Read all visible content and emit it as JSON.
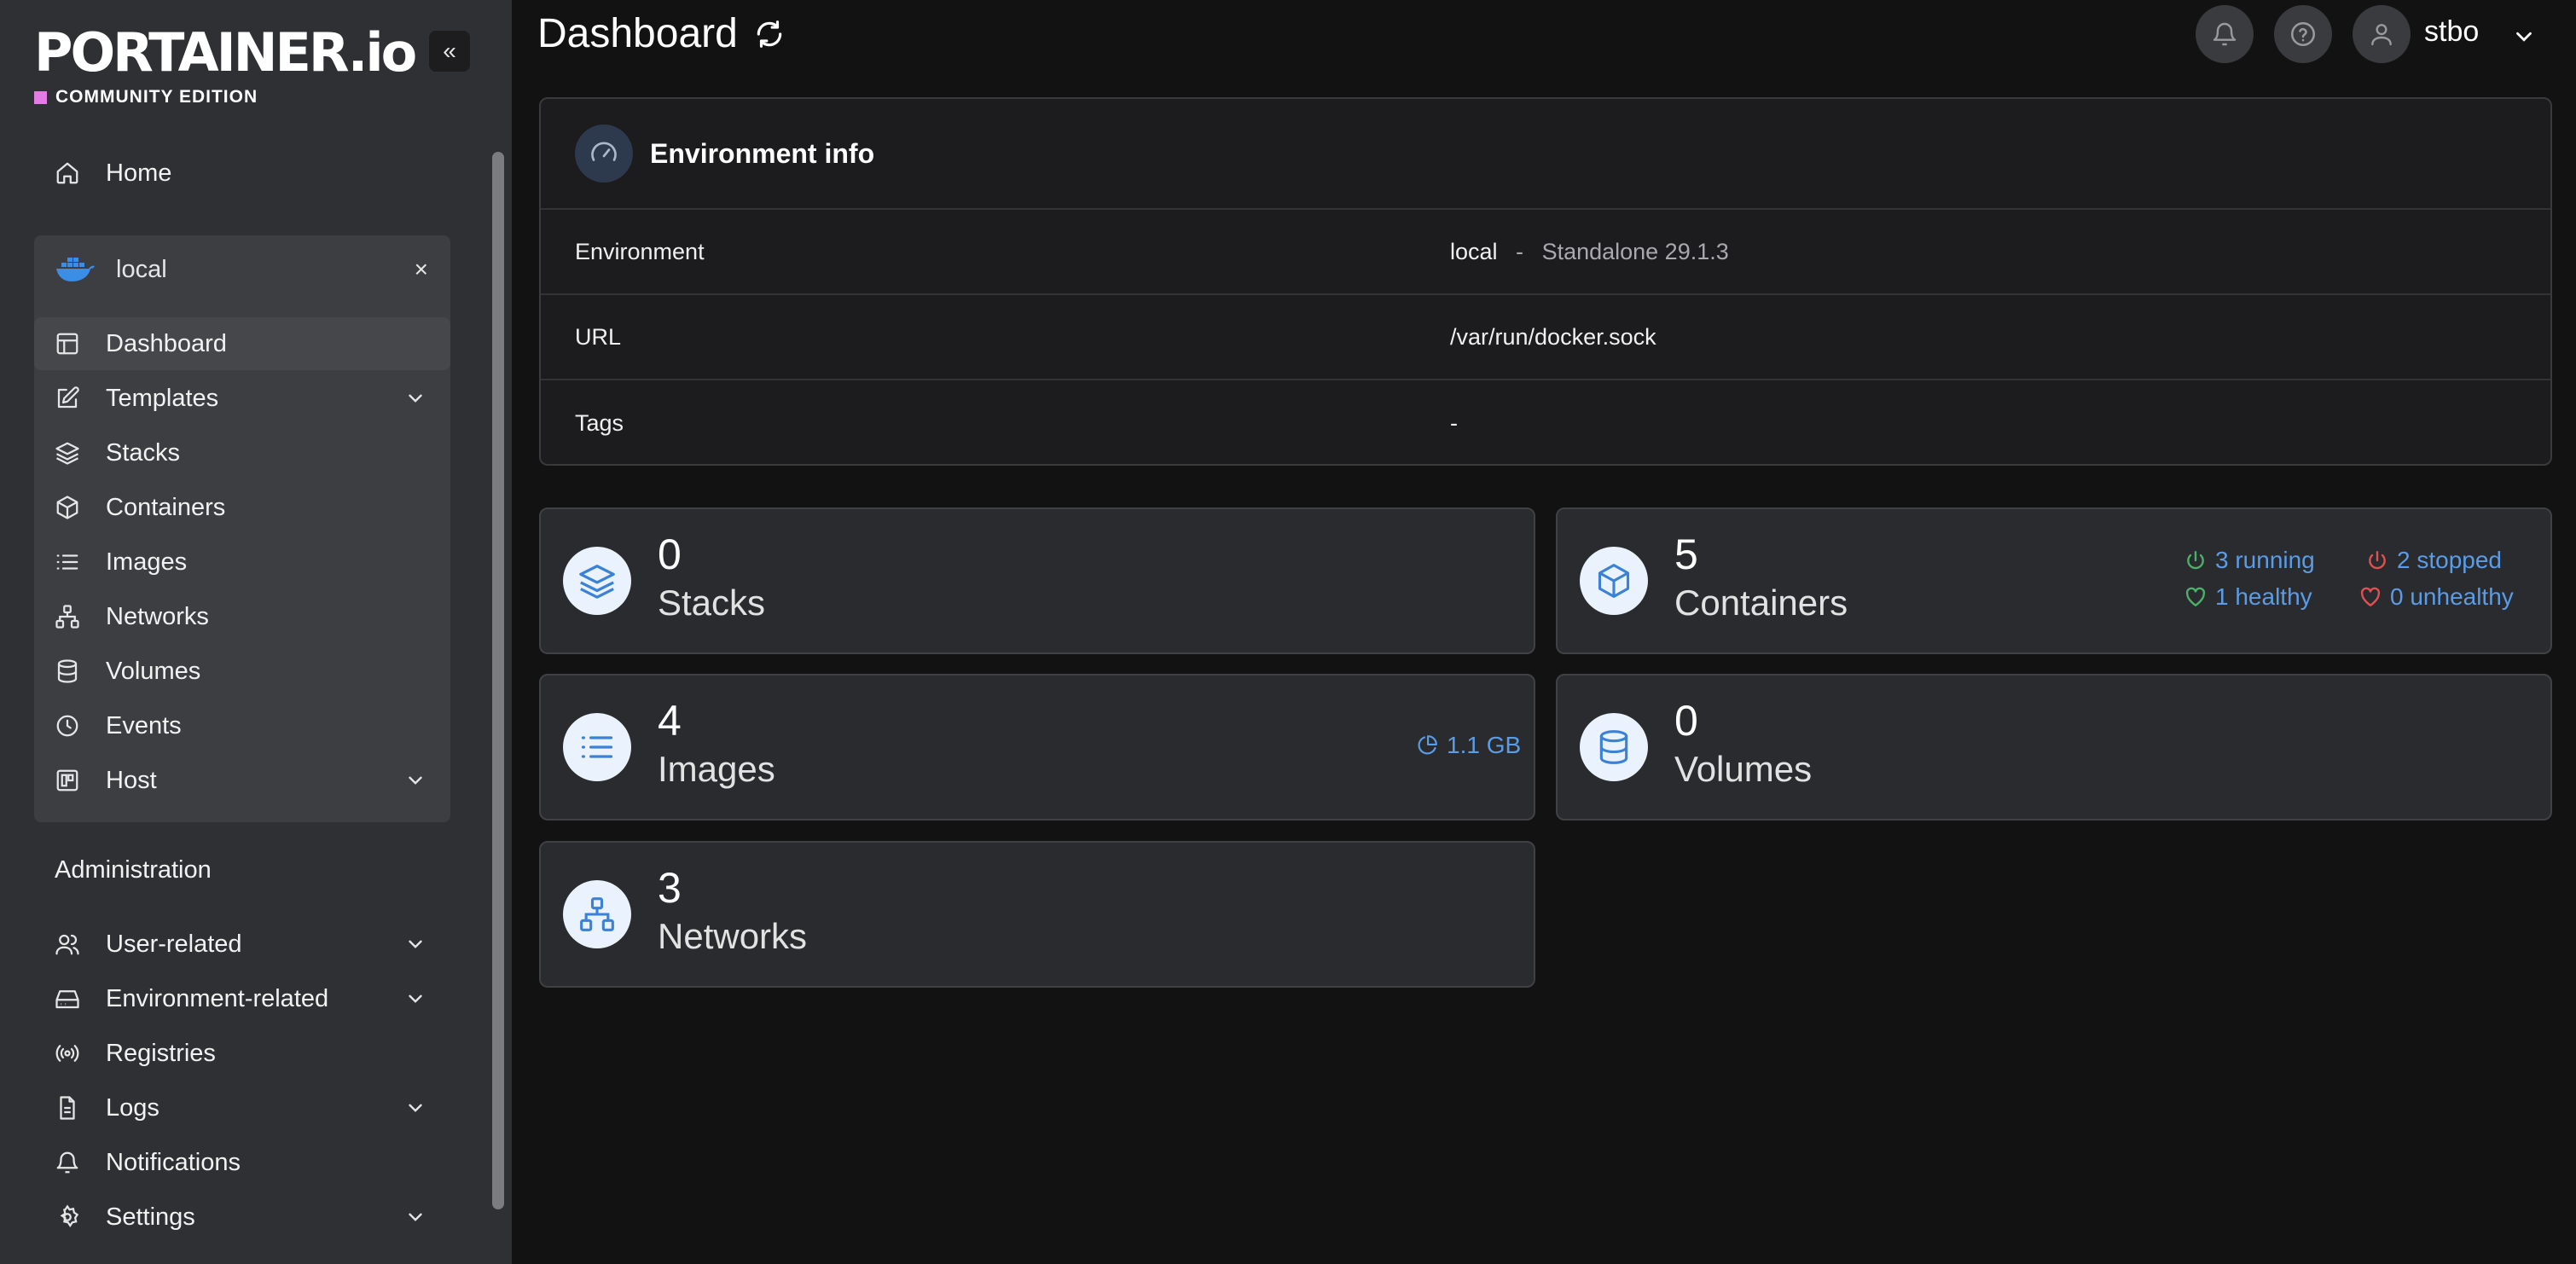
{
  "brand": {
    "name": "PORTAINER.io",
    "edition": "COMMUNITY EDITION",
    "accent": "#e57ce6"
  },
  "sidebar": {
    "collapse_label": "«",
    "home": "Home",
    "environment": {
      "name": "local",
      "close": "×"
    },
    "env_items": [
      "Dashboard",
      "Templates",
      "Stacks",
      "Containers",
      "Images",
      "Networks",
      "Volumes",
      "Events",
      "Host"
    ],
    "admin_label": "Administration",
    "admin_items": [
      "User-related",
      "Environment-related",
      "Registries",
      "Logs",
      "Notifications",
      "Settings"
    ]
  },
  "header": {
    "title": "Dashboard",
    "user": "stbo"
  },
  "env_info": {
    "title": "Environment info",
    "rows": [
      {
        "key": "Environment",
        "value": "local",
        "dash": "-",
        "extra": "Standalone 29.1.3"
      },
      {
        "key": "URL",
        "value": "/var/run/docker.sock"
      },
      {
        "key": "Tags",
        "value": "-"
      }
    ]
  },
  "stats": {
    "stacks": {
      "count": "0",
      "label": "Stacks"
    },
    "containers": {
      "count": "5",
      "label": "Containers",
      "running": "3 running",
      "stopped": "2 stopped",
      "healthy": "1 healthy",
      "unhealthy": "0 unhealthy"
    },
    "images": {
      "count": "4",
      "label": "Images",
      "size": "1.1 GB"
    },
    "volumes": {
      "count": "0",
      "label": "Volumes"
    },
    "networks": {
      "count": "3",
      "label": "Networks"
    }
  },
  "colors": {
    "link_blue": "#5b9ce6",
    "running_green": "#4caf6a",
    "stopped_red": "#e05252",
    "sidebar_bg": "#2f3033",
    "page_bg": "#121212"
  }
}
